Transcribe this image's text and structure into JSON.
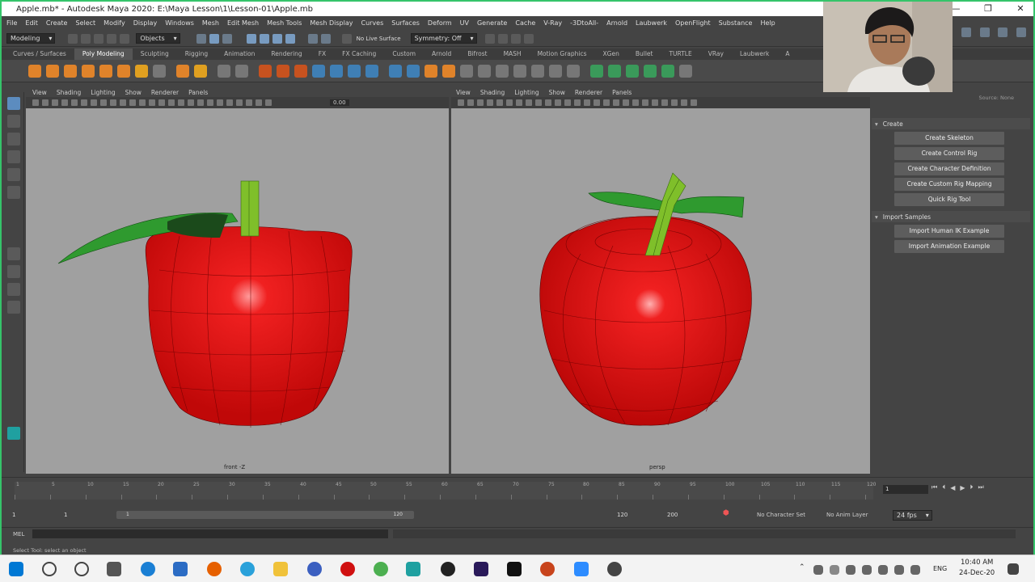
{
  "window": {
    "title": "Apple.mb* - Autodesk Maya 2020: E:\\Maya Lesson\\1\\Lesson-01\\Apple.mb",
    "controls": [
      "—",
      "❐",
      "✕"
    ]
  },
  "menubar": [
    "File",
    "Edit",
    "Create",
    "Select",
    "Modify",
    "Display",
    "Windows",
    "Mesh",
    "Edit Mesh",
    "Mesh Tools",
    "Mesh Display",
    "Curves",
    "Surfaces",
    "Deform",
    "UV",
    "Generate",
    "Cache",
    "V-Ray",
    "-3DtoAll-",
    "Arnold",
    "Laubwerk",
    "OpenFlight",
    "Substance",
    "Help"
  ],
  "statusline": {
    "mode": "Modeling",
    "objects_label": "Objects",
    "live_surface": "No Live Surface",
    "symmetry": "Symmetry: Off"
  },
  "shelf_tabs": [
    "Curves / Surfaces",
    "Poly Modeling",
    "Sculpting",
    "Rigging",
    "Animation",
    "Rendering",
    "FX",
    "FX Caching",
    "Custom",
    "Arnold",
    "Bifrost",
    "MASH",
    "Motion Graphics",
    "XGen",
    "Bullet",
    "TURTLE",
    "VRay",
    "Laubwerk",
    "A"
  ],
  "shelf_active": "Poly Modeling",
  "left_panel": {
    "menus": [
      "View",
      "Shading",
      "Lighting",
      "Show",
      "Renderer",
      "Panels"
    ],
    "value": "0.00",
    "camera_label": "front -Z"
  },
  "right_panel": {
    "menus": [
      "View",
      "Shading",
      "Lighting",
      "Show",
      "Renderer",
      "Panels"
    ],
    "camera_label": "persp"
  },
  "attr_panel": {
    "source_label": "Source: None",
    "sections": [
      {
        "title": "Create",
        "buttons": [
          "Create Skeleton",
          "Create Control Rig",
          "Create Character Definition",
          "Create Custom Rig Mapping",
          "Quick Rig Tool"
        ]
      },
      {
        "title": "Import Samples",
        "buttons": [
          "Import Human IK Example",
          "Import Animation Example"
        ]
      }
    ]
  },
  "timeline": {
    "ticks": [
      "1",
      "5",
      "10",
      "15",
      "20",
      "25",
      "30",
      "35",
      "40",
      "45",
      "50",
      "55",
      "60",
      "65",
      "70",
      "75",
      "80",
      "85",
      "90",
      "95",
      "100",
      "105",
      "110",
      "115",
      "120"
    ],
    "current_frame": "1"
  },
  "range": {
    "start": "1",
    "playback_start": "1",
    "range_start_label": "1",
    "range_end_label": "120",
    "playback_end": "120",
    "end": "200",
    "character_set": "No Character Set",
    "anim_layer": "No Anim Layer",
    "fps": "24 fps"
  },
  "cmdline": {
    "label": "MEL"
  },
  "help_line": "Select Tool: select an object",
  "taskbar": {
    "time": "10:40 AM",
    "date": "24-Dec-20",
    "lang": "ENG"
  },
  "colors": {
    "apple": "#e01010",
    "leaf": "#2f9a2f",
    "stem": "#7fbf2a",
    "viewport": "#a0a0a0",
    "accent": "#35c46a"
  }
}
